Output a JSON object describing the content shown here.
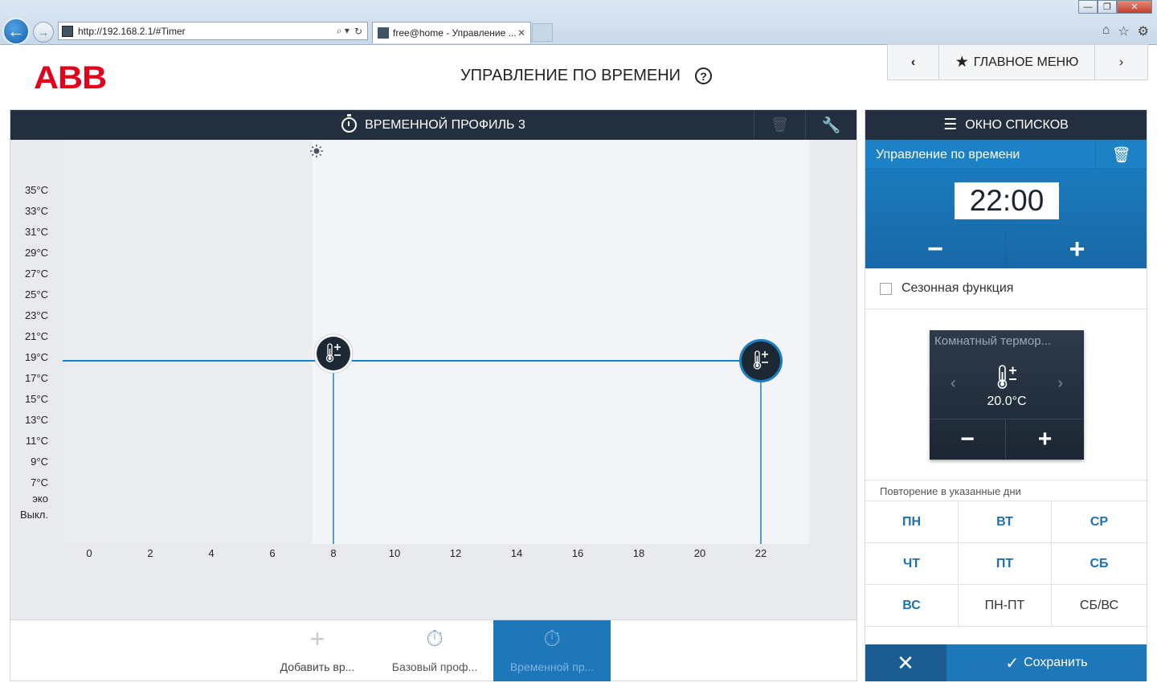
{
  "browser": {
    "address": "http://192.168.2.1/#Timer",
    "tab_title": "free@home - Управление ...",
    "back_icon": "arrow-left-icon",
    "forward_icon": "arrow-right-icon"
  },
  "app": {
    "logo_text": "ABB",
    "title": "УПРАВЛЕНИЕ ПО ВРЕМЕНИ",
    "help_label": "?",
    "nav": {
      "back_label": "‹",
      "main_menu_label": "ГЛАВНОЕ МЕНЮ",
      "forward_label": "›"
    },
    "colors": {
      "brand_red": "#e2001a",
      "header_dark": "#232f3e",
      "accent_blue": "#1e77b8",
      "line_blue": "#1d7ec2"
    }
  },
  "profile_panel": {
    "title": "ВРЕМЕННОЙ ПРОФИЛЬ 3",
    "delete_icon": "trash-icon",
    "settings_icon": "wrench-icon"
  },
  "chart_data": {
    "type": "line",
    "y_tick_labels": [
      "35°C",
      "33°C",
      "31°C",
      "29°C",
      "27°C",
      "25°C",
      "23°C",
      "21°C",
      "19°C",
      "17°C",
      "15°C",
      "13°C",
      "11°C",
      "9°C",
      "7°C",
      "эко",
      "Выкл."
    ],
    "x_ticks": [
      0,
      2,
      4,
      6,
      8,
      10,
      12,
      14,
      16,
      18,
      20,
      22
    ],
    "x_range": [
      0,
      24
    ],
    "sun_marker_hour": 7.5,
    "day_shade_from_hour": 7.3,
    "setpoints": [
      {
        "hour": 8,
        "temp": 20,
        "selected": false
      },
      {
        "hour": 22,
        "temp": 19,
        "selected": true
      }
    ],
    "line_temp": 19
  },
  "bottom_bar": {
    "add_label": "Добавить вр...",
    "base_label": "Базовый проф...",
    "active_label": "Временной пр..."
  },
  "list_panel": {
    "title": "ОКНО СПИСКОВ",
    "subheader": "Управление по времени",
    "time": "22:00",
    "minus": "−",
    "plus": "+",
    "season_label": "Сезонная функция",
    "season_checked": false,
    "thermostat": {
      "name": "Комнатный термор...",
      "value": "20.0°C",
      "minus": "−",
      "plus": "+"
    },
    "repeat_label": "Повторение в указанные дни",
    "days": [
      {
        "label": "ПН",
        "active": true
      },
      {
        "label": "ВТ",
        "active": true
      },
      {
        "label": "СР",
        "active": true
      },
      {
        "label": "ЧТ",
        "active": true
      },
      {
        "label": "ПТ",
        "active": true
      },
      {
        "label": "СБ",
        "active": true
      },
      {
        "label": "ВС",
        "active": true
      },
      {
        "label": "ПН-ПТ",
        "active": false
      },
      {
        "label": "СБ/ВС",
        "active": false
      }
    ],
    "cancel_label": "✕",
    "save_label": "Сохранить"
  }
}
